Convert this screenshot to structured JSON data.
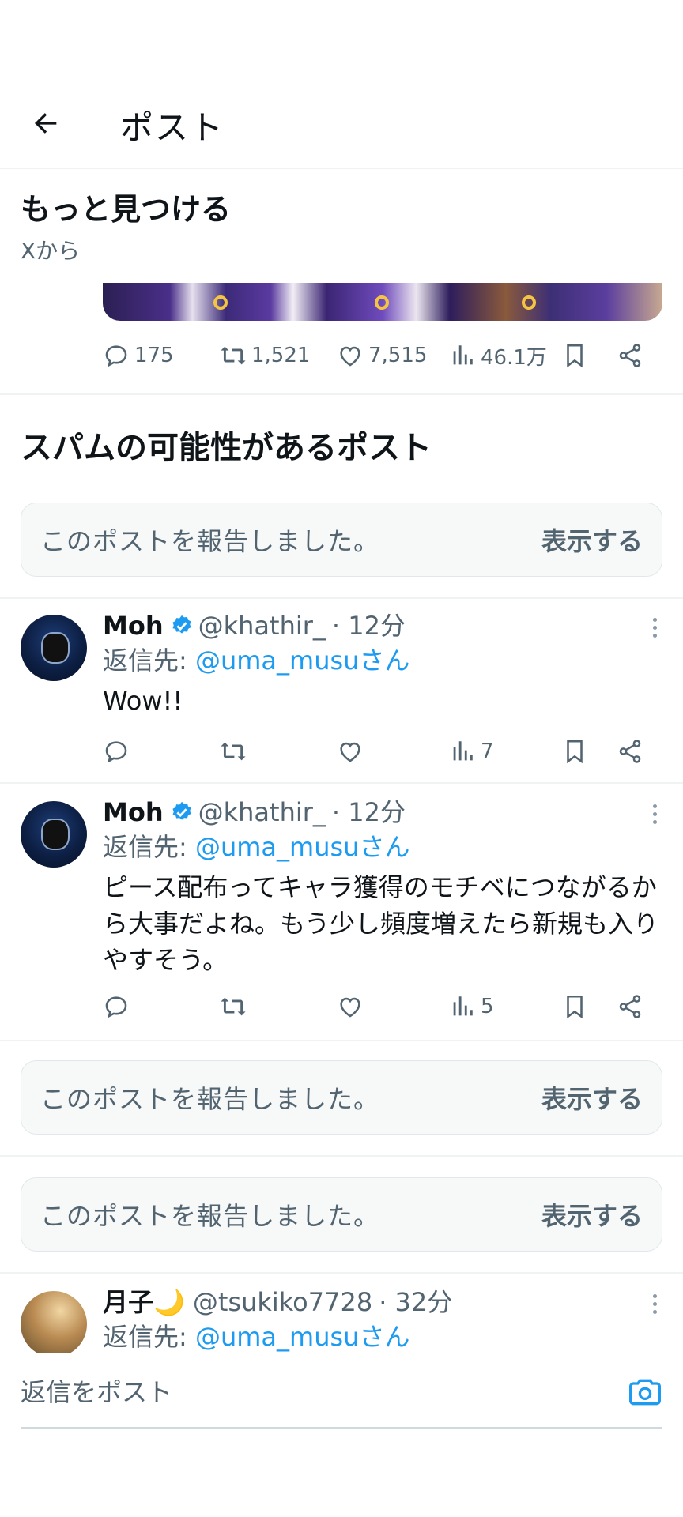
{
  "header": {
    "title": "ポスト"
  },
  "discover": {
    "title": "もっと見つける",
    "subtitle": "Xから"
  },
  "featured_actions": {
    "replies": "175",
    "reposts": "1,521",
    "likes": "7,515",
    "views": "46.1万"
  },
  "spam_section": {
    "title": "スパムの可能性があるポスト"
  },
  "reported": {
    "text": "このポストを報告しました。",
    "show_label": "表示する"
  },
  "posts": [
    {
      "name": "Moh",
      "handle": "@khathir_",
      "time": "· 12分",
      "reply_prefix": "返信先: ",
      "reply_mention": "@uma_musuさん",
      "body": "Wow!!",
      "views": "7"
    },
    {
      "name": "Moh",
      "handle": "@khathir_",
      "time": "· 12分",
      "reply_prefix": "返信先: ",
      "reply_mention": "@uma_musuさん",
      "body": "ピース配布ってキャラ獲得のモチベにつながるから大事だよね。もう少し頻度増えたら新規も入りやすそう。",
      "views": "5"
    },
    {
      "name": "月子🌙",
      "handle": "@tsukiko7728",
      "time": "· 32分",
      "reply_prefix": "返信先: ",
      "reply_mention": "@uma_musuさん"
    }
  ],
  "compose": {
    "placeholder": "返信をポスト"
  },
  "colors": {
    "accent": "#1d9bf0",
    "secondary_text": "#536471",
    "separator": "#eff3f4"
  },
  "icons": [
    "back-arrow-icon",
    "reply-icon",
    "repost-icon",
    "like-icon",
    "views-icon",
    "bookmark-icon",
    "share-icon",
    "verified-badge-icon",
    "more-icon",
    "camera-icon"
  ]
}
